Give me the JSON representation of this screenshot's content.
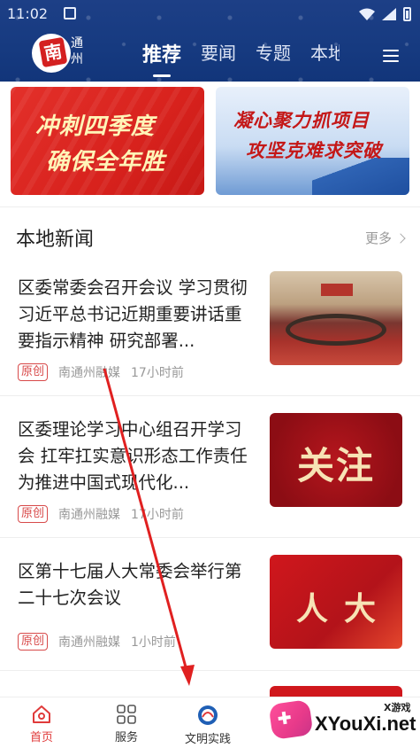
{
  "status_bar": {
    "time": "11:02"
  },
  "app": {
    "logo_seal": "南",
    "logo_text": "通州"
  },
  "tabs": [
    {
      "label": "推荐",
      "active": true
    },
    {
      "label": "要闻",
      "active": false
    },
    {
      "label": "专题",
      "active": false
    },
    {
      "label": "本地",
      "active": false
    }
  ],
  "banners": [
    {
      "line1": "冲刺四季度",
      "line2": "确保全年胜"
    },
    {
      "line1": "凝心聚力抓项目",
      "line2": "攻坚克难求突破"
    }
  ],
  "section": {
    "title": "本地新闻",
    "more": "更多"
  },
  "news": [
    {
      "title": "区委常委会召开会议 学习贯彻习近平总书记近期重要讲话重要指示精神 研究部署...",
      "badge": "原创",
      "source": "南通州融媒",
      "time": "17小时前",
      "thumb": "meeting-photo"
    },
    {
      "title": "区委理论学习中心组召开学习会 扛牢扛实意识形态工作责任 为推进中国式现代化...",
      "badge": "原创",
      "source": "南通州融媒",
      "time": "17小时前",
      "thumb_text": "关注"
    },
    {
      "title": "区第十七届人大常委会举行第二十七次会议",
      "badge": "原创",
      "source": "南通州融媒",
      "time": "1小时前",
      "thumb_text": "人大"
    }
  ],
  "bottom_nav": [
    {
      "label": "首页",
      "icon": "home-icon",
      "active": true
    },
    {
      "label": "服务",
      "icon": "grid-icon",
      "active": false
    },
    {
      "label": "文明实践",
      "icon": "emblem-icon",
      "active": false
    }
  ],
  "watermark": {
    "small": "X游戏",
    "big": "XYouXi.net"
  },
  "colors": {
    "header": "#1a3c84",
    "accent": "#e03b3b",
    "badge": "#d84a4a"
  }
}
